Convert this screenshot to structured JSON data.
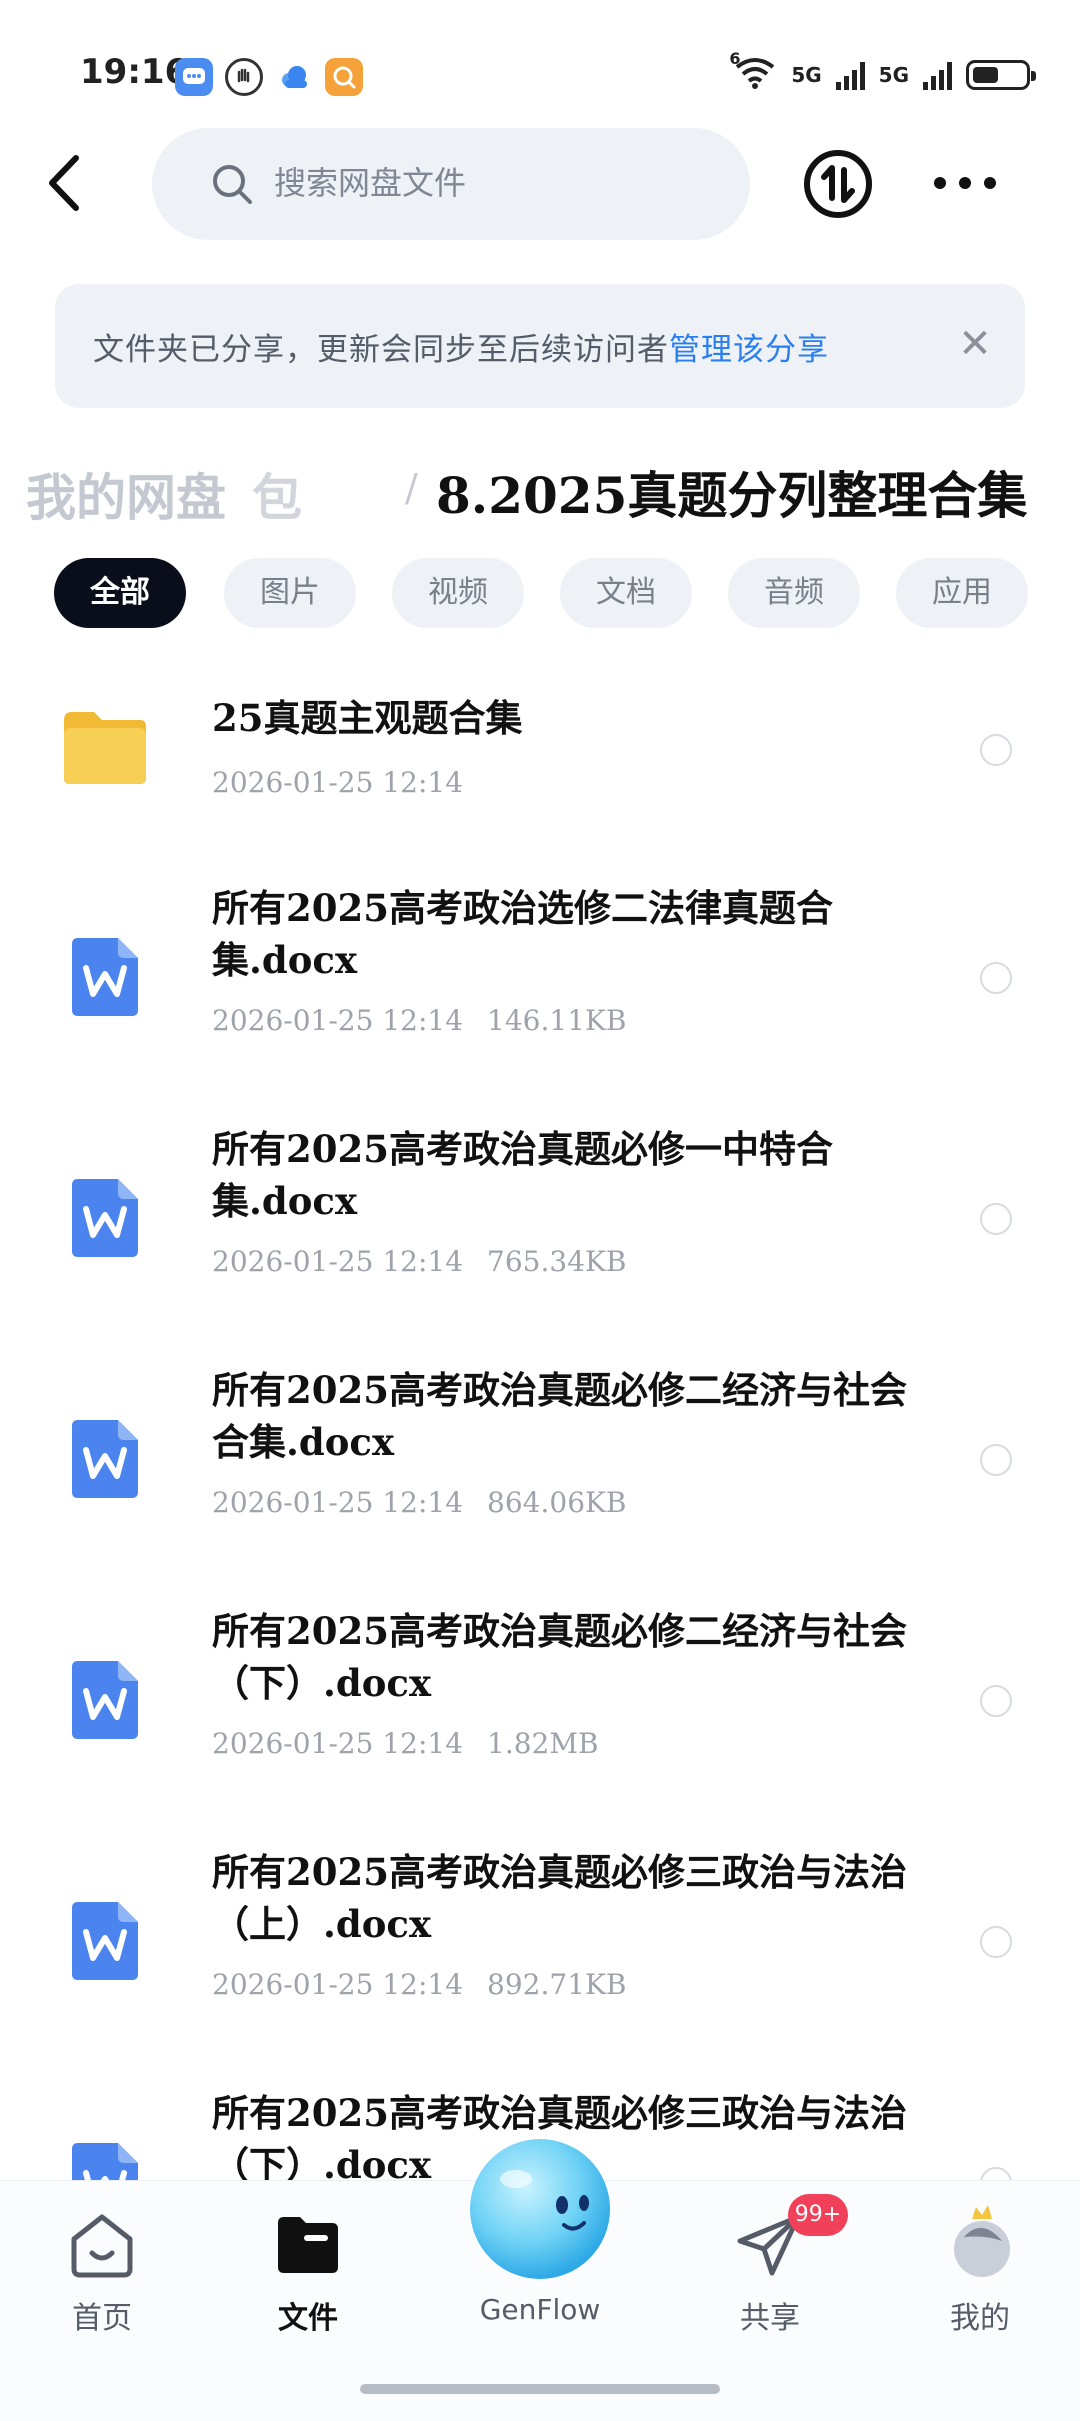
{
  "status_bar": {
    "time": "19:16",
    "net_left": "6",
    "sim1": "5G",
    "sim2": "5G",
    "battery_level": 0.5
  },
  "top_bar": {
    "search_placeholder": "搜索网盘文件"
  },
  "banner": {
    "text": "文件夹已分享，更新会同步至后续访问者",
    "link": "管理该分享",
    "close_icon": "close-icon"
  },
  "breadcrumb": {
    "root": "我的网盘",
    "root_tail": "包",
    "separator": "/",
    "current": "8.2025真题分列整理合集"
  },
  "tabs": [
    "全部",
    "图片",
    "视频",
    "文档",
    "音频",
    "应用"
  ],
  "files": [
    {
      "name": "25真题主观题合集",
      "date": "2026-01-25 12:14",
      "size": "",
      "type": "folder"
    },
    {
      "name": "所有2025高考政治选修二法律真题合集.docx",
      "date": "2026-01-25 12:14",
      "size": "146.11KB",
      "type": "word"
    },
    {
      "name": "所有2025高考政治真题必修一中特合集.docx",
      "date": "2026-01-25 12:14",
      "size": "765.34KB",
      "type": "word"
    },
    {
      "name": "所有2025高考政治真题必修二经济与社会合集.docx",
      "date": "2026-01-25 12:14",
      "size": "864.06KB",
      "type": "word"
    },
    {
      "name": "所有2025高考政治真题必修二经济与社会（下）.docx",
      "date": "2026-01-25 12:14",
      "size": "1.82MB",
      "type": "word"
    },
    {
      "name": "所有2025高考政治真题必修三政治与法治（上）.docx",
      "date": "2026-01-25 12:14",
      "size": "892.71KB",
      "type": "word"
    },
    {
      "name": "所有2025高考政治真题必修三政治与法治（下）.docx",
      "date": "",
      "size": "",
      "type": "word"
    }
  ],
  "bottom_nav": {
    "items": [
      {
        "label": "首页",
        "icon": "home-icon"
      },
      {
        "label": "文件",
        "icon": "folder-icon"
      },
      {
        "label": "GenFlow",
        "icon": "genflow-mascot-icon"
      },
      {
        "label": "共享",
        "icon": "send-icon"
      },
      {
        "label": "我的",
        "icon": "profile-icon"
      }
    ],
    "share_badge": "99+"
  },
  "colors": {
    "accent_link": "#2a7ff0",
    "word_icon": "#4b84ee",
    "folder_icon": "#f7c94a",
    "badge": "#f0405a"
  }
}
